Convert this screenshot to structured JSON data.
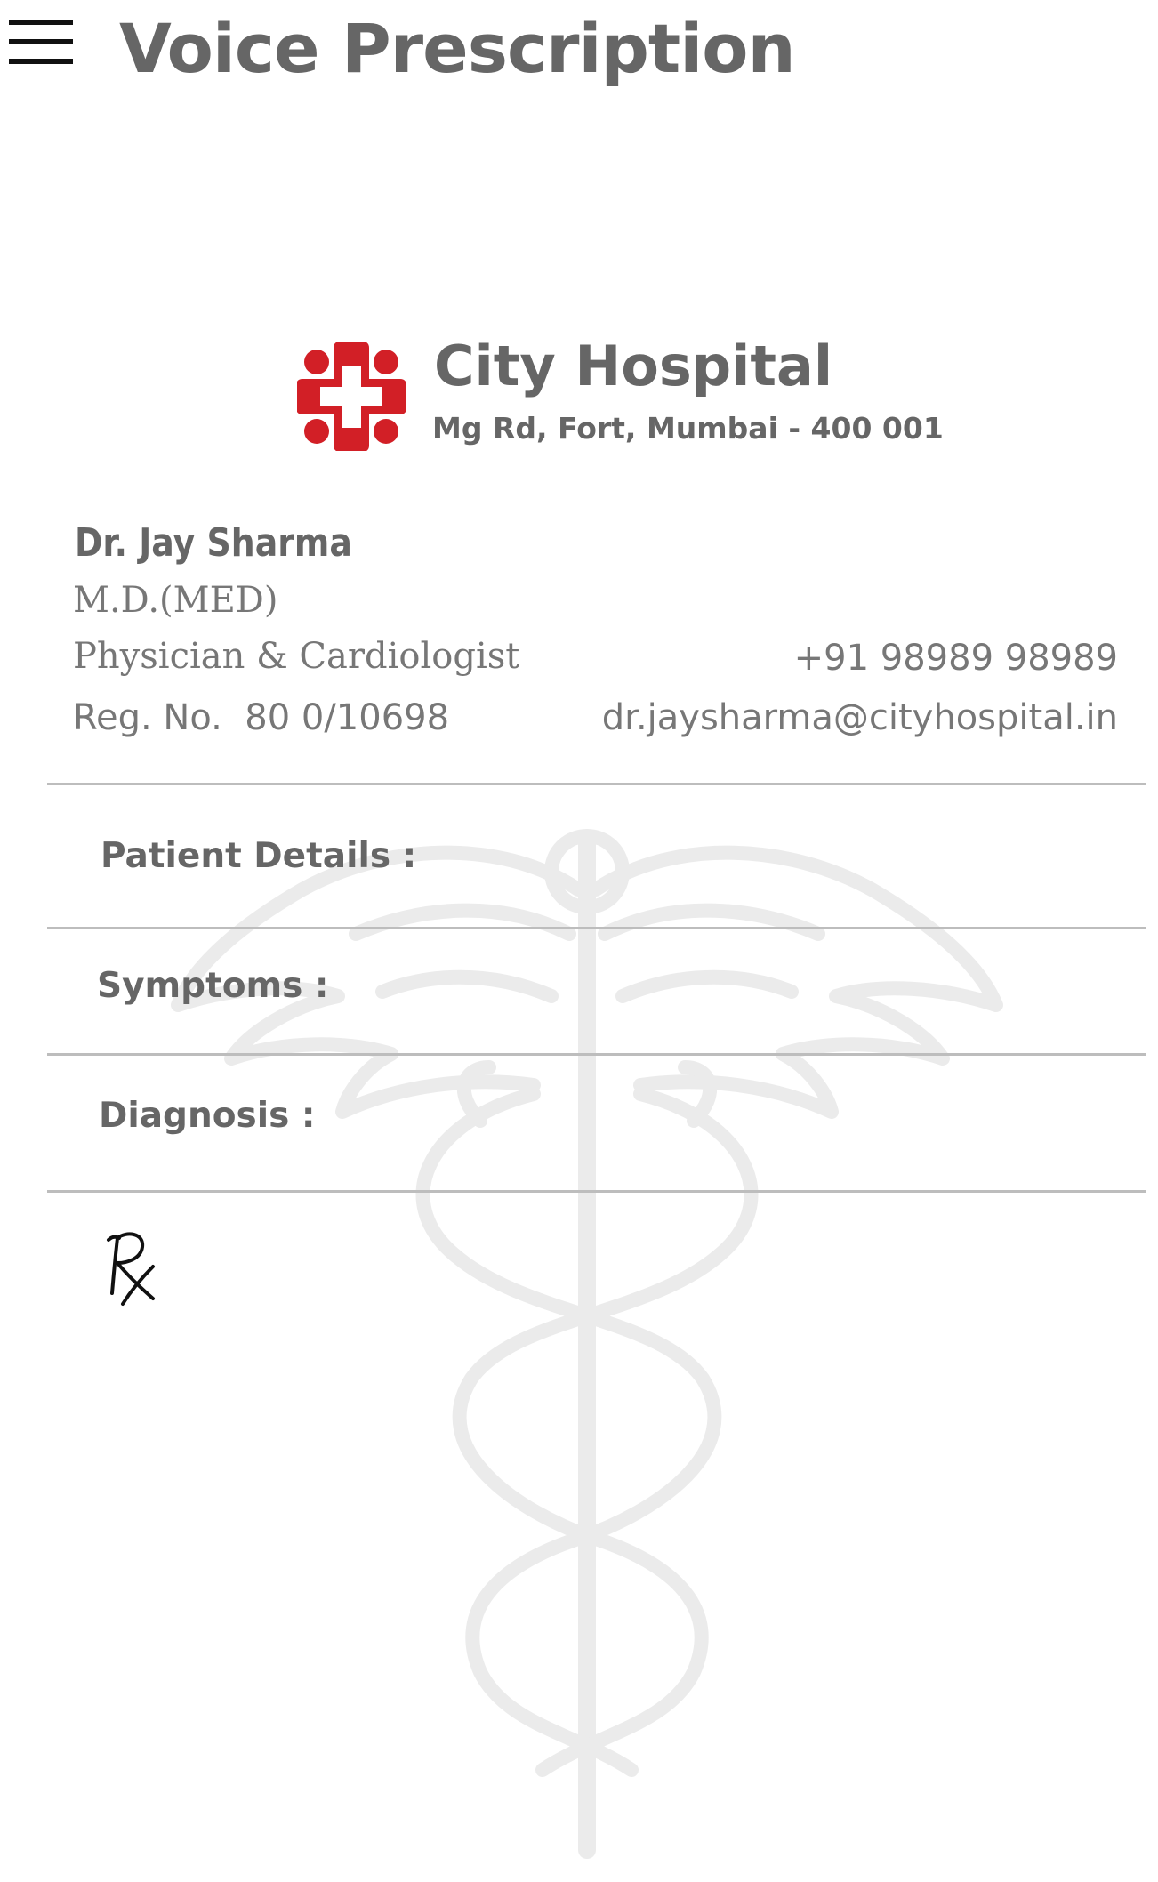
{
  "app_bar": {
    "title": "Voice Prescription",
    "menu_icon": "hamburger-menu-icon"
  },
  "hospital": {
    "name": "City Hospital",
    "address": "Mg Rd, Fort, Mumbai - 400 001",
    "logo_icon": "medical-cross-icon",
    "logo_color": "#d21f26"
  },
  "doctor": {
    "name": "Dr. Jay Sharma",
    "degree": "M.D.(MED)",
    "specialty": "Physician & Cardiologist",
    "registration": "Reg. No.  80 0/10698",
    "phone": "+91 98989 98989",
    "email": "dr.jaysharma@cityhospital.in"
  },
  "sections": {
    "patient_details": "Patient Details :",
    "symptoms": "Symptoms :",
    "diagnosis": "Diagnosis :"
  },
  "prescription": {
    "rx_icon": "rx-symbol-icon"
  },
  "watermark": {
    "icon": "caduceus-watermark-icon"
  },
  "colors": {
    "text_primary": "#666666",
    "text_secondary": "#777777",
    "divider": "#bdbdbd",
    "accent_red": "#d21f26"
  }
}
